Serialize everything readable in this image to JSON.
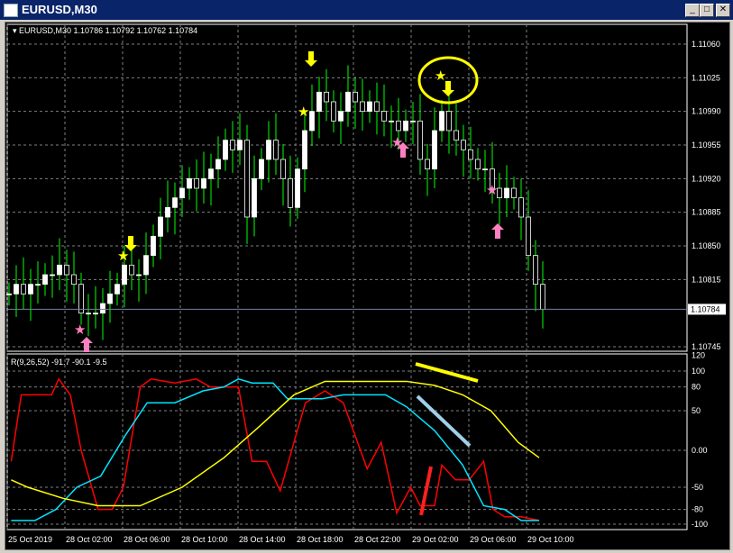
{
  "window": {
    "title": "EURUSD,M30",
    "buttons": [
      "minimize",
      "maximize",
      "close"
    ]
  },
  "chart": {
    "header": "EURUSD,M30  1.10786 1.10792 1.10762 1.10784",
    "price_ticks": [
      "1.11060",
      "1.11025",
      "1.10990",
      "1.10955",
      "1.10920",
      "1.10885",
      "1.10850",
      "1.10815",
      "1.10745"
    ],
    "current_price": "1.10784",
    "time_ticks": [
      "25 Oct 2019",
      "28 Oct 02:00",
      "28 Oct 06:00",
      "28 Oct 10:00",
      "28 Oct 14:00",
      "28 Oct 18:00",
      "28 Oct 22:00",
      "29 Oct 02:00",
      "29 Oct 06:00",
      "29 Oct 10:00"
    ],
    "closes": [
      1.108,
      1.1081,
      1.108,
      1.1081,
      1.1081,
      1.1082,
      1.1082,
      1.1083,
      1.1082,
      1.1081,
      1.1078,
      1.1078,
      1.1078,
      1.1079,
      1.108,
      1.1081,
      1.1083,
      1.1082,
      1.1082,
      1.1084,
      1.1086,
      1.1088,
      1.1089,
      1.109,
      1.1091,
      1.1092,
      1.1091,
      1.1092,
      1.1093,
      1.1094,
      1.1096,
      1.1095,
      1.1096,
      1.1088,
      1.1092,
      1.1094,
      1.1096,
      1.1094,
      1.1092,
      1.1089,
      1.1093,
      1.1097,
      1.1099,
      1.1101,
      1.11,
      1.1098,
      1.1099,
      1.1101,
      1.11,
      1.1099,
      1.11,
      1.1099,
      1.1098,
      1.1098,
      1.1097,
      1.1098,
      1.1098,
      1.1094,
      1.1093,
      1.1097,
      1.1099,
      1.1097,
      1.1096,
      1.1095,
      1.1094,
      1.1093,
      1.1093,
      1.1091,
      1.109,
      1.1091,
      1.109,
      1.1088,
      1.1084,
      1.1081,
      1.10784
    ]
  },
  "indicator": {
    "label": "R(9,26,52) -91.7 -90.1 -9.5",
    "ticks": [
      "120",
      "100",
      "80",
      "50",
      "0.00",
      "-50",
      "-80",
      "-100"
    ],
    "series": [
      {
        "name": "red",
        "color": "#ff0000",
        "points": [
          [
            0.3,
            -15
          ],
          [
            1.7,
            70
          ],
          [
            5.9,
            70
          ],
          [
            6.9,
            90
          ],
          [
            8.5,
            70
          ],
          [
            10,
            0
          ],
          [
            12.35,
            -80
          ],
          [
            14.3,
            -80
          ],
          [
            15.85,
            -50
          ],
          [
            18.2,
            80
          ],
          [
            19.7,
            90
          ],
          [
            23,
            85
          ],
          [
            25.95,
            90
          ],
          [
            27.9,
            80
          ],
          [
            31.8,
            80
          ],
          [
            33.7,
            -15
          ],
          [
            35.7,
            -15
          ],
          [
            37.6,
            -55
          ],
          [
            39.5,
            10
          ],
          [
            41.1,
            60
          ],
          [
            43.8,
            75
          ],
          [
            46.35,
            60
          ],
          [
            49.65,
            -25
          ],
          [
            51.6,
            10
          ],
          [
            53.75,
            -85
          ],
          [
            55.7,
            -50
          ],
          [
            57,
            -75
          ],
          [
            59,
            -75
          ],
          [
            60,
            -20
          ],
          [
            61.9,
            -40
          ],
          [
            63.8,
            -40
          ],
          [
            65.8,
            -15
          ],
          [
            67.1,
            -80
          ],
          [
            68.7,
            -90
          ],
          [
            71,
            -90
          ],
          [
            73.5,
            -95
          ]
        ]
      },
      {
        "name": "cyan",
        "color": "#00e5ff",
        "points": [
          [
            0.3,
            -95
          ],
          [
            3.6,
            -95
          ],
          [
            6.5,
            -80
          ],
          [
            9.4,
            -50
          ],
          [
            12.7,
            -35
          ],
          [
            16.2,
            20
          ],
          [
            19.15,
            60
          ],
          [
            23,
            60
          ],
          [
            26.9,
            75
          ],
          [
            29.8,
            80
          ],
          [
            31.8,
            90
          ],
          [
            33.7,
            85
          ],
          [
            36.6,
            85
          ],
          [
            38.6,
            65
          ],
          [
            43.4,
            65
          ],
          [
            46.35,
            70
          ],
          [
            52.2,
            70
          ],
          [
            55.1,
            55
          ],
          [
            59,
            25
          ],
          [
            62.9,
            -20
          ],
          [
            65.8,
            -75
          ],
          [
            68.7,
            -80
          ],
          [
            71,
            -95
          ],
          [
            73.5,
            -95
          ]
        ]
      },
      {
        "name": "yellow",
        "color": "#ffff00",
        "points": [
          [
            0.3,
            -40
          ],
          [
            2.6,
            -50
          ],
          [
            7.5,
            -65
          ],
          [
            12.35,
            -75
          ],
          [
            18.2,
            -75
          ],
          [
            24,
            -50
          ],
          [
            29.8,
            -10
          ],
          [
            34.7,
            30
          ],
          [
            39.5,
            70
          ],
          [
            43.8,
            87
          ],
          [
            55.1,
            87
          ],
          [
            59,
            82
          ],
          [
            62.9,
            70
          ],
          [
            66.8,
            50
          ],
          [
            70.6,
            10
          ],
          [
            73.5,
            -10
          ]
        ]
      }
    ]
  },
  "colors": {
    "bull": "#ffffff",
    "bear": "#000000",
    "wick": "#00ff00",
    "grid": "#808080",
    "annot_yellow": "#ffff00",
    "annot_pink": "#ff80c0"
  }
}
